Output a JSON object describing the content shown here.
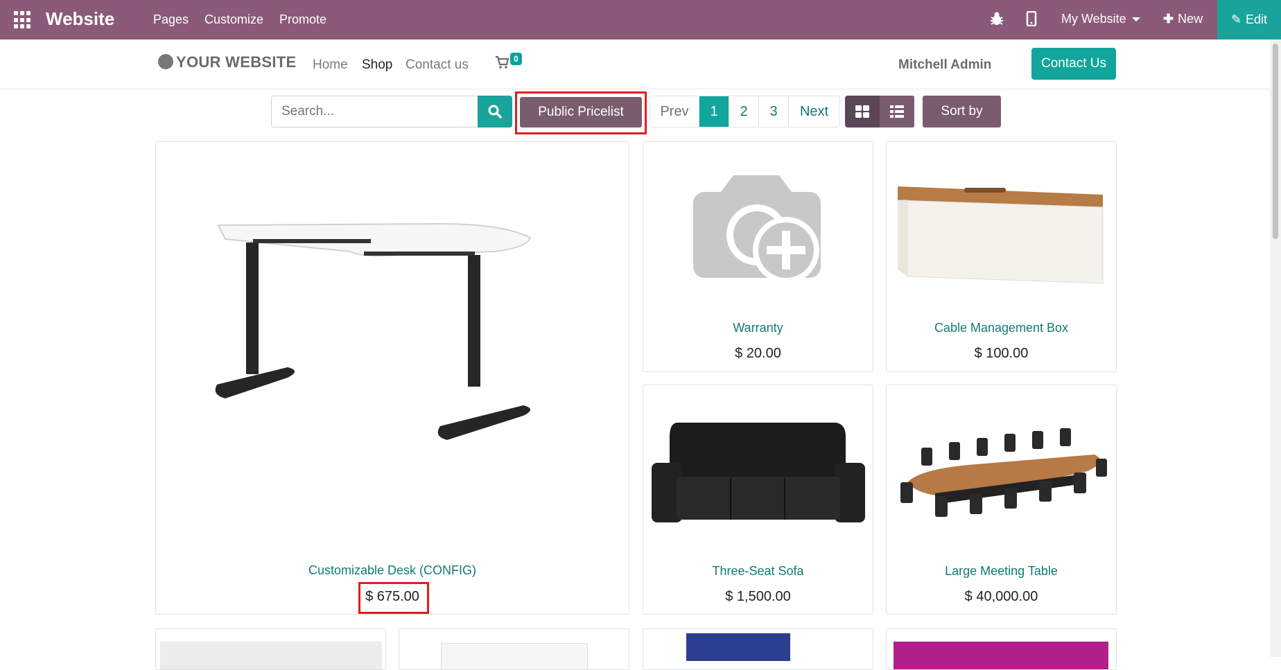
{
  "topbar": {
    "app_title": "Website",
    "menu": [
      "Pages",
      "Customize",
      "Promote"
    ],
    "my_website": "My Website",
    "new_label": "New",
    "edit_label": "Edit",
    "colors": {
      "bar": "#8a5a78",
      "edit": "#1aa39b"
    }
  },
  "navbar": {
    "logo_text": "YOUR WEBSITE",
    "links": [
      "Home",
      "Shop",
      "Contact us"
    ],
    "active_link": "Shop",
    "cart_count": "0",
    "user_name": "Mitchell Admin",
    "contact_button": "Contact Us"
  },
  "toolbar": {
    "search_placeholder": "Search...",
    "pricelist_label": "Public Pricelist",
    "pager": [
      "Prev",
      "1",
      "2",
      "3",
      "Next"
    ],
    "pager_active": "1",
    "sort_label": "Sort by"
  },
  "products": [
    {
      "name": "Customizable Desk (CONFIG)",
      "price": "$ 675.00",
      "image": "desk"
    },
    {
      "name": "Warranty",
      "price": "$ 20.00",
      "image": "camera-placeholder-icon"
    },
    {
      "name": "Cable Management Box",
      "price": "$ 100.00",
      "image": "cable-box"
    },
    {
      "name": "Three-Seat Sofa",
      "price": "$ 1,500.00",
      "image": "sofa"
    },
    {
      "name": "Large Meeting Table",
      "price": "$ 40,000.00",
      "image": "meeting-table"
    }
  ]
}
